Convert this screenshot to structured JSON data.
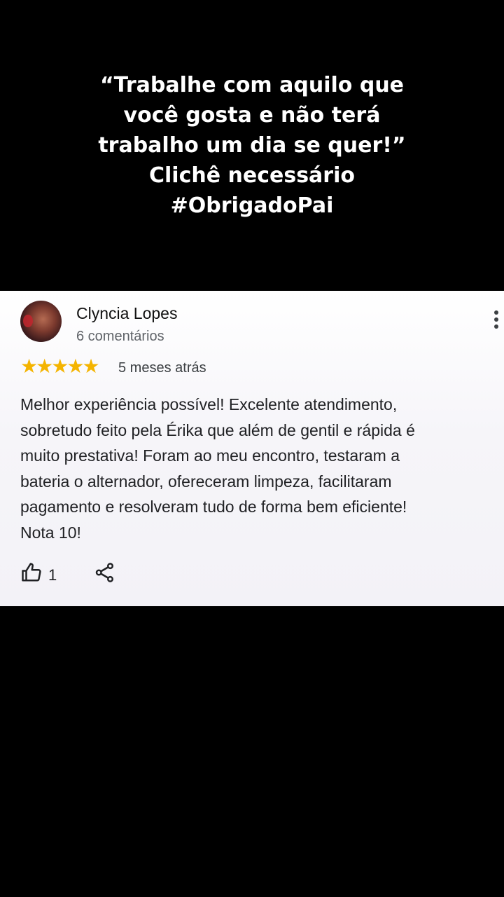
{
  "caption": {
    "lines": [
      "“Trabalhe com aquilo que",
      "você gosta e não terá",
      "trabalho um dia se quer!”",
      "Clichê necessário",
      "#ObrigadoPai"
    ]
  },
  "review": {
    "reviewer_name": "Clyncia Lopes",
    "review_count": "6 comentários",
    "rating": 5,
    "rating_max": 5,
    "star_glyph": "★",
    "star_color": "#f4b400",
    "date": "5 meses atrás",
    "lines": [
      "Melhor experiência possível! Excelente atendimento,",
      "sobretudo feito pela Érika que além de gentil e rápida é",
      "muito prestativa! Foram ao meu encontro, testaram a",
      "bateria o alternador, ofereceram limpeza, facilitaram",
      "pagamento e resolveram tudo de forma bem eficiente!",
      "Nota 10!"
    ],
    "likes": "1",
    "icons": {
      "avatar": "avatar-photo",
      "more": "more-vert-icon",
      "like": "thumbs-up-icon",
      "share": "share-icon"
    }
  }
}
